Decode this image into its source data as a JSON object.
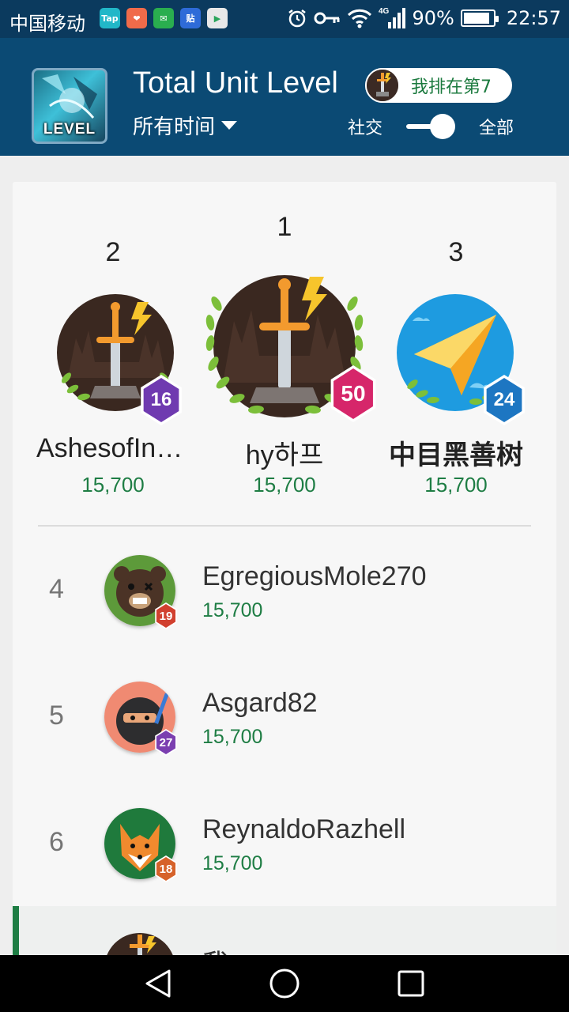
{
  "status_bar": {
    "carrier": "中国移动",
    "apps": [
      {
        "name": "taptap-icon",
        "label": "Tap",
        "color": "#21b7c8"
      },
      {
        "name": "xiaohongshu-icon",
        "label": "❤",
        "color": "#f06b4a"
      },
      {
        "name": "wechat-icon",
        "label": "✉",
        "color": "#2aae4f"
      },
      {
        "name": "tieba-icon",
        "label": "贴",
        "color": "#2e6bd8"
      },
      {
        "name": "play-store-icon",
        "label": "▶",
        "color": "#e8e8e8"
      }
    ],
    "network": "4G",
    "battery": "90%",
    "battery_level": 0.9,
    "time": "22:57"
  },
  "header": {
    "game_icon_text": "LEVEL",
    "title": "Total Unit Level",
    "time_filter": "所有时间",
    "my_rank": "我排在第7",
    "toggle_left": "社交",
    "toggle_right": "全部"
  },
  "podium": [
    {
      "rank": "2",
      "name": "AshesofInfinity",
      "score": "15,700",
      "level": "16",
      "badge_color": "#6f3ab0"
    },
    {
      "rank": "1",
      "name": "hy하프",
      "score": "15,700",
      "level": "50",
      "badge_color": "#d6266a"
    },
    {
      "rank": "3",
      "name": "中目黑善树",
      "score": "15,700",
      "level": "24",
      "badge_color": "#1d76c2"
    }
  ],
  "rows": [
    {
      "rank": "4",
      "name": "EgregiousMole270",
      "score": "15,700",
      "level": "19",
      "badge_color": "#d1402f"
    },
    {
      "rank": "5",
      "name": "Asgard82",
      "score": "15,700",
      "level": "27",
      "badge_color": "#7b3fb0"
    },
    {
      "rank": "6",
      "name": "ReynaldoRazhell",
      "score": "15,700",
      "level": "18",
      "badge_color": "#d6622a"
    }
  ],
  "me_row": {
    "label": "我"
  },
  "nav": {
    "back": "back",
    "home": "home",
    "recents": "recents"
  }
}
